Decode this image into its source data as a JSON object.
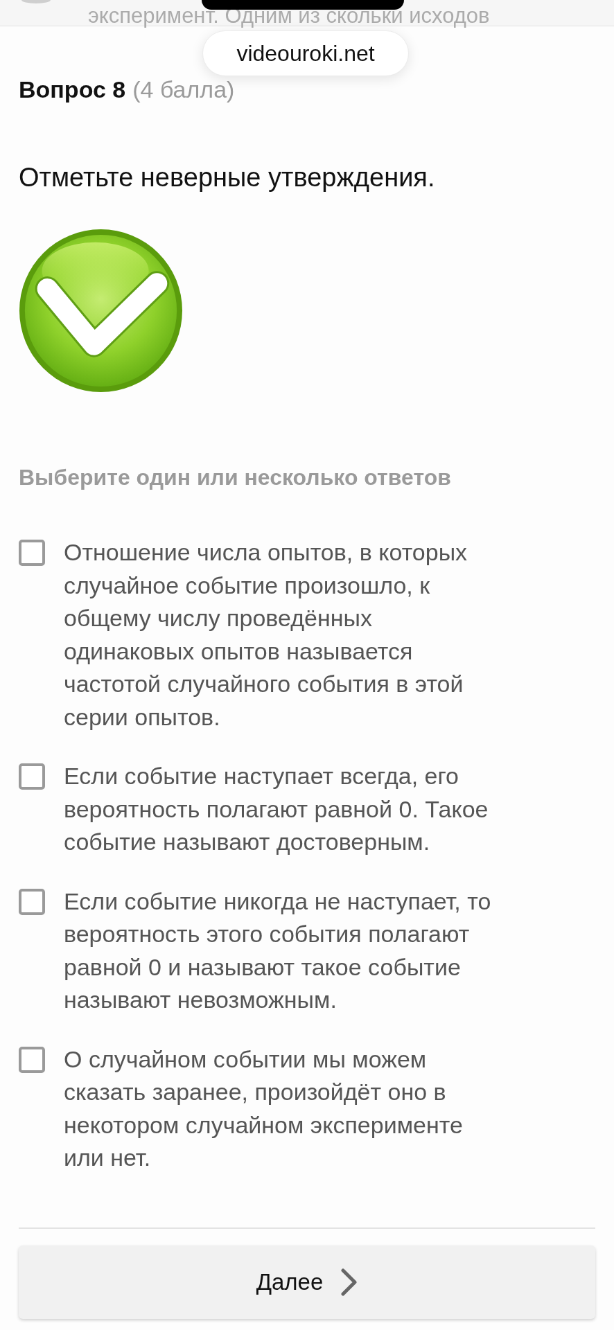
{
  "background_text": "эксперимент. Одним из скольки исходов",
  "address_pill": {
    "text": "videouroki.net"
  },
  "question": {
    "title": "Вопрос 8",
    "points": "(4 балла)",
    "prompt": "Отметьте неверные утверждения.",
    "instruction": "Выберите один или несколько ответов",
    "options": [
      {
        "text": "Отношение числа опытов, в которых случайное событие произошло, к общему числу проведённых одинаковых опытов называется частотой случайного события в этой серии опытов.",
        "checked": false
      },
      {
        "text": "Если событие наступает всегда, его вероятность полагают равной 0. Такое событие называют достоверным.",
        "checked": false
      },
      {
        "text": "Если событие никогда не наступает, то вероятность этого события полагают равной 0 и называют такое событие называют невозможным.",
        "checked": false
      },
      {
        "text": "О случайном событии мы можем сказать заранее, произойдёт оно в некотором случайном эксперименте или нет.",
        "checked": false
      }
    ]
  },
  "next_button": {
    "label": "Далее"
  }
}
